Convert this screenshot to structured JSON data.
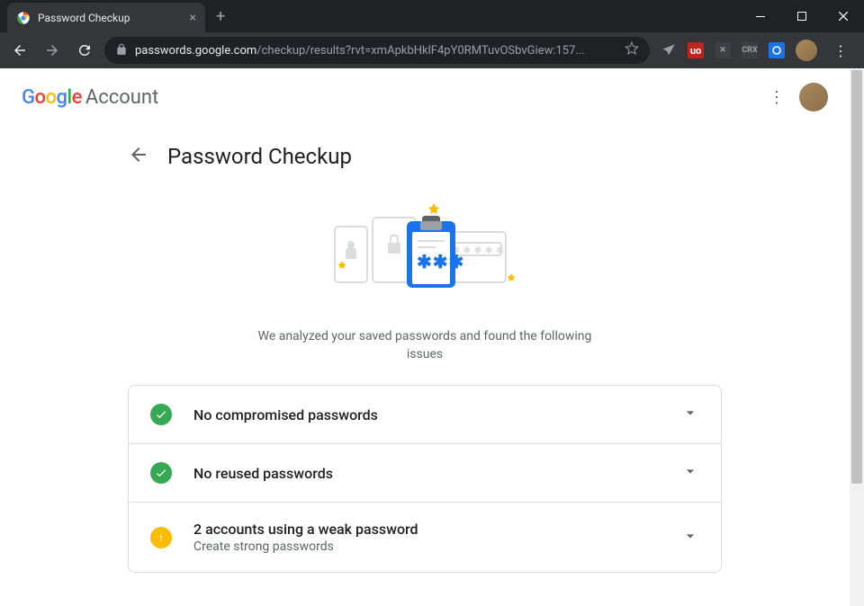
{
  "browser": {
    "tab_title": "Password Checkup",
    "url_host": "passwords.google.com",
    "url_path": "/checkup/results?rvt=xmApkbHklF4pY0RMTuvOSbvGiew:157..."
  },
  "header": {
    "logo_text": "Google",
    "account_text": "Account"
  },
  "main": {
    "page_title": "Password Checkup",
    "hero_text": "We analyzed your saved passwords and found the following issues"
  },
  "results": [
    {
      "status": "ok",
      "title": "No compromised passwords",
      "subtitle": ""
    },
    {
      "status": "ok",
      "title": "No reused passwords",
      "subtitle": ""
    },
    {
      "status": "warn",
      "title": "2 accounts using a weak password",
      "subtitle": "Create strong passwords"
    }
  ]
}
